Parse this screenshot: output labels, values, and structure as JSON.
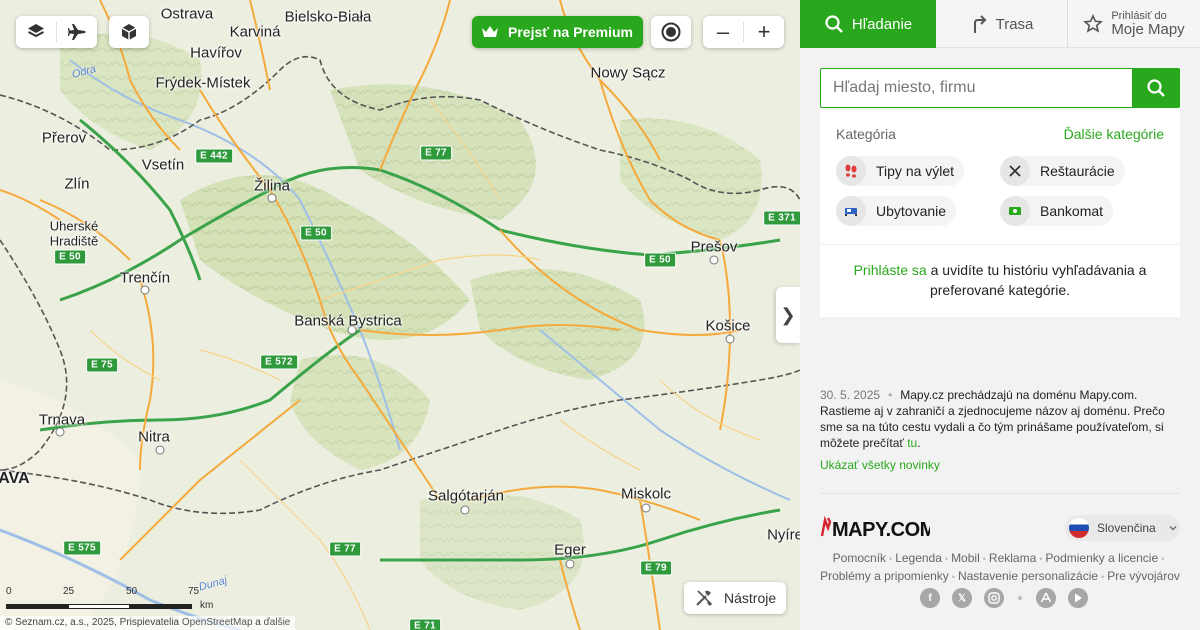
{
  "map": {
    "premium_label": "Prejsť na Premium",
    "tools_label": "Nástroje",
    "collapse_glyph": "❯",
    "zoom_out": "–",
    "zoom_in": "+",
    "cities": [
      {
        "name": "Ostrava",
        "big": false,
        "bold": false
      },
      {
        "name": "Bielsko-Biała",
        "big": false,
        "bold": false
      },
      {
        "name": "Havířov",
        "big": false,
        "bold": false
      },
      {
        "name": "Karviná",
        "big": false,
        "bold": false
      },
      {
        "name": "Frýdek-Místek",
        "big": false,
        "bold": false
      },
      {
        "name": "Nowy Sącz",
        "big": false,
        "bold": false
      },
      {
        "name": "Přerov",
        "big": false,
        "bold": false
      },
      {
        "name": "Vsetín",
        "big": false,
        "bold": false
      },
      {
        "name": "Zlín",
        "big": false,
        "bold": false
      },
      {
        "name": "Žilina",
        "big": false,
        "bold": false
      },
      {
        "name": "Uherské",
        "big": false,
        "bold": false
      },
      {
        "name": "Hradiště",
        "big": false,
        "bold": false
      },
      {
        "name": "Prešov",
        "big": false,
        "bold": false
      },
      {
        "name": "Trenčín",
        "big": false,
        "bold": false
      },
      {
        "name": "Banská Bystrica",
        "big": false,
        "bold": false
      },
      {
        "name": "Košice",
        "big": false,
        "bold": false
      },
      {
        "name": "Trnava",
        "big": false,
        "bold": false
      },
      {
        "name": "Nitra",
        "big": false,
        "bold": false
      },
      {
        "name": "AVA",
        "big": true,
        "bold": true
      },
      {
        "name": "Salgótarján",
        "big": false,
        "bold": false
      },
      {
        "name": "Miskolc",
        "big": false,
        "bold": false
      },
      {
        "name": "Eger",
        "big": false,
        "bold": false
      },
      {
        "name": "Nyíre",
        "big": false,
        "bold": false
      }
    ],
    "roads": [
      "E 442",
      "E 77",
      "E 371",
      "E 50",
      "E 50",
      "E 50",
      "E 572",
      "E 75",
      "E 575",
      "E 77",
      "E 79",
      "E 71"
    ],
    "rivers": [
      "Odra",
      "Dunaj"
    ],
    "scale": {
      "t0": "0",
      "t25": "25",
      "t50": "50",
      "t75": "75",
      "unit": "km"
    },
    "copyright": {
      "prefix": "© Seznam.cz, a.s., 2025",
      "middle": ", Prispievatelia ",
      "osm": "OpenStreetMap",
      "and": " a ",
      "more": "ďalšie"
    }
  },
  "panel": {
    "tabs": {
      "search": "Hľadanie",
      "route": "Trasa",
      "login_small": "Prihlásiť do",
      "login_main": "Moje Mapy"
    },
    "search": {
      "placeholder": "Hľadaj miesto, firmu",
      "value": ""
    },
    "categories": {
      "label": "Kategória",
      "more": "Ďalšie kategórie",
      "items": [
        {
          "label": "Tipy na výlet",
          "icon": "footprints-icon"
        },
        {
          "label": "Reštaurácie",
          "icon": "cutlery-icon"
        },
        {
          "label": "Ubytovanie",
          "icon": "bed-icon"
        },
        {
          "label": "Bankomat",
          "icon": "cash-icon"
        }
      ],
      "login_link": "Prihláste sa",
      "login_rest": " a uvidíte tu históriu vyhľadávania a preferované kategórie."
    },
    "news": {
      "date": "30. 5. 2025",
      "text": "Mapy.cz prechádzajú na doménu Mapy.com. Rastieme aj v zahraničí a zjednocujeme názov aj doménu. Prečo sme sa na túto cestu vydali a čo tým prinášame používateľom, si môžete prečítať ",
      "link": "tu",
      "end": ".",
      "all": "Ukázať všetky novinky"
    },
    "logo": "MAPY.COM",
    "language": "Slovenčina",
    "footer_row1": [
      "Pomocník",
      "Legenda",
      "Mobil",
      "Reklama",
      "Podmienky a licencie"
    ],
    "footer_row2": [
      "Problémy a pripomienky",
      "Nastavenie personalizácie",
      "Pre vývojárov"
    ],
    "social": [
      "facebook-icon",
      "x-icon",
      "instagram-icon",
      "app-store-icon",
      "google-play-icon"
    ],
    "colors": {
      "accent": "#2aa81d"
    }
  }
}
